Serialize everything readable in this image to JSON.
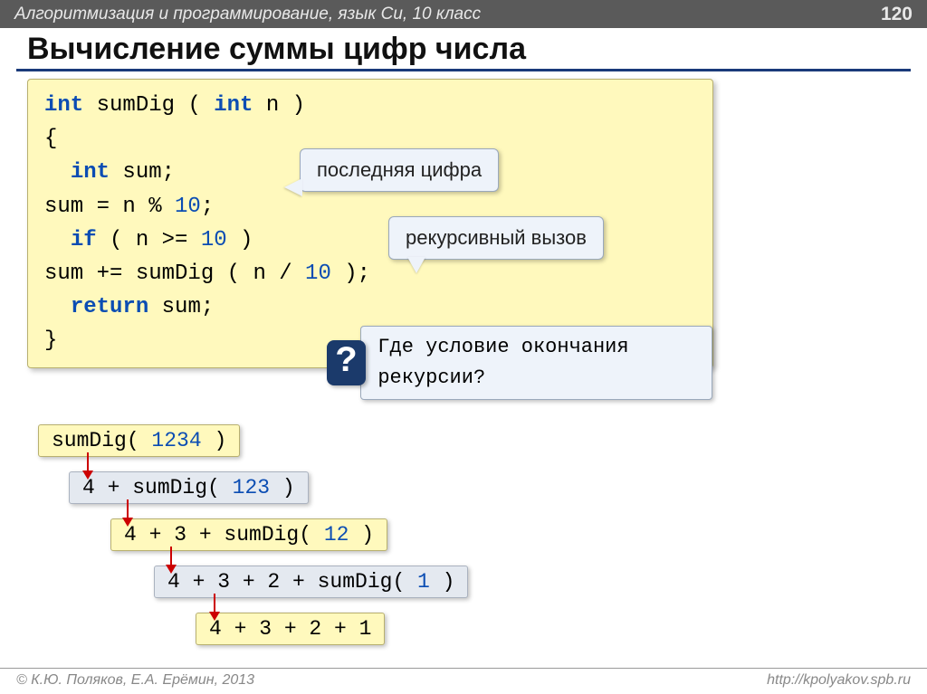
{
  "header": {
    "course": "Алгоритмизация и программирование, язык Си, 10 класс",
    "page_number": "120"
  },
  "title": "Вычисление суммы цифр числа",
  "code": {
    "l1_int": "int",
    "l1_name": " sumDig ( ",
    "l1_int2": "int",
    "l1_tail": " n )",
    "l2": "{",
    "l3_int": "int",
    "l3_rest": " sum;",
    "l4_a": "  sum = n % ",
    "l4_num": "10",
    "l4_b": ";",
    "l5_if": "if",
    "l5_a": " ( n >= ",
    "l5_num": "10",
    "l5_b": " )",
    "l6_a": "    sum += sumDig ( n / ",
    "l6_num": "10",
    "l6_b": " );",
    "l7_ret": "return",
    "l7_rest": " sum;",
    "l8": "}"
  },
  "callouts": {
    "last_digit": "последняя цифра",
    "recursive_call": "рекурсивный вызов"
  },
  "question": {
    "mark": "?",
    "text": "Где условие окончания рекурсии?"
  },
  "trace": {
    "t0_a": "sumDig( ",
    "t0_n": "1234",
    "t0_b": " )",
    "t1_a": "4 + sumDig( ",
    "t1_n": "123",
    "t1_b": " )",
    "t2_a": "4 + 3 + sumDig( ",
    "t2_n": "12",
    "t2_b": " )",
    "t3_a": "4 + 3 + 2 + sumDig( ",
    "t3_n": "1",
    "t3_b": " )",
    "t4": "4 + 3 + 2 + 1"
  },
  "footer": {
    "left": "© К.Ю. Поляков, Е.А. Ерёмин, 2013",
    "right": "http://kpolyakov.spb.ru"
  }
}
